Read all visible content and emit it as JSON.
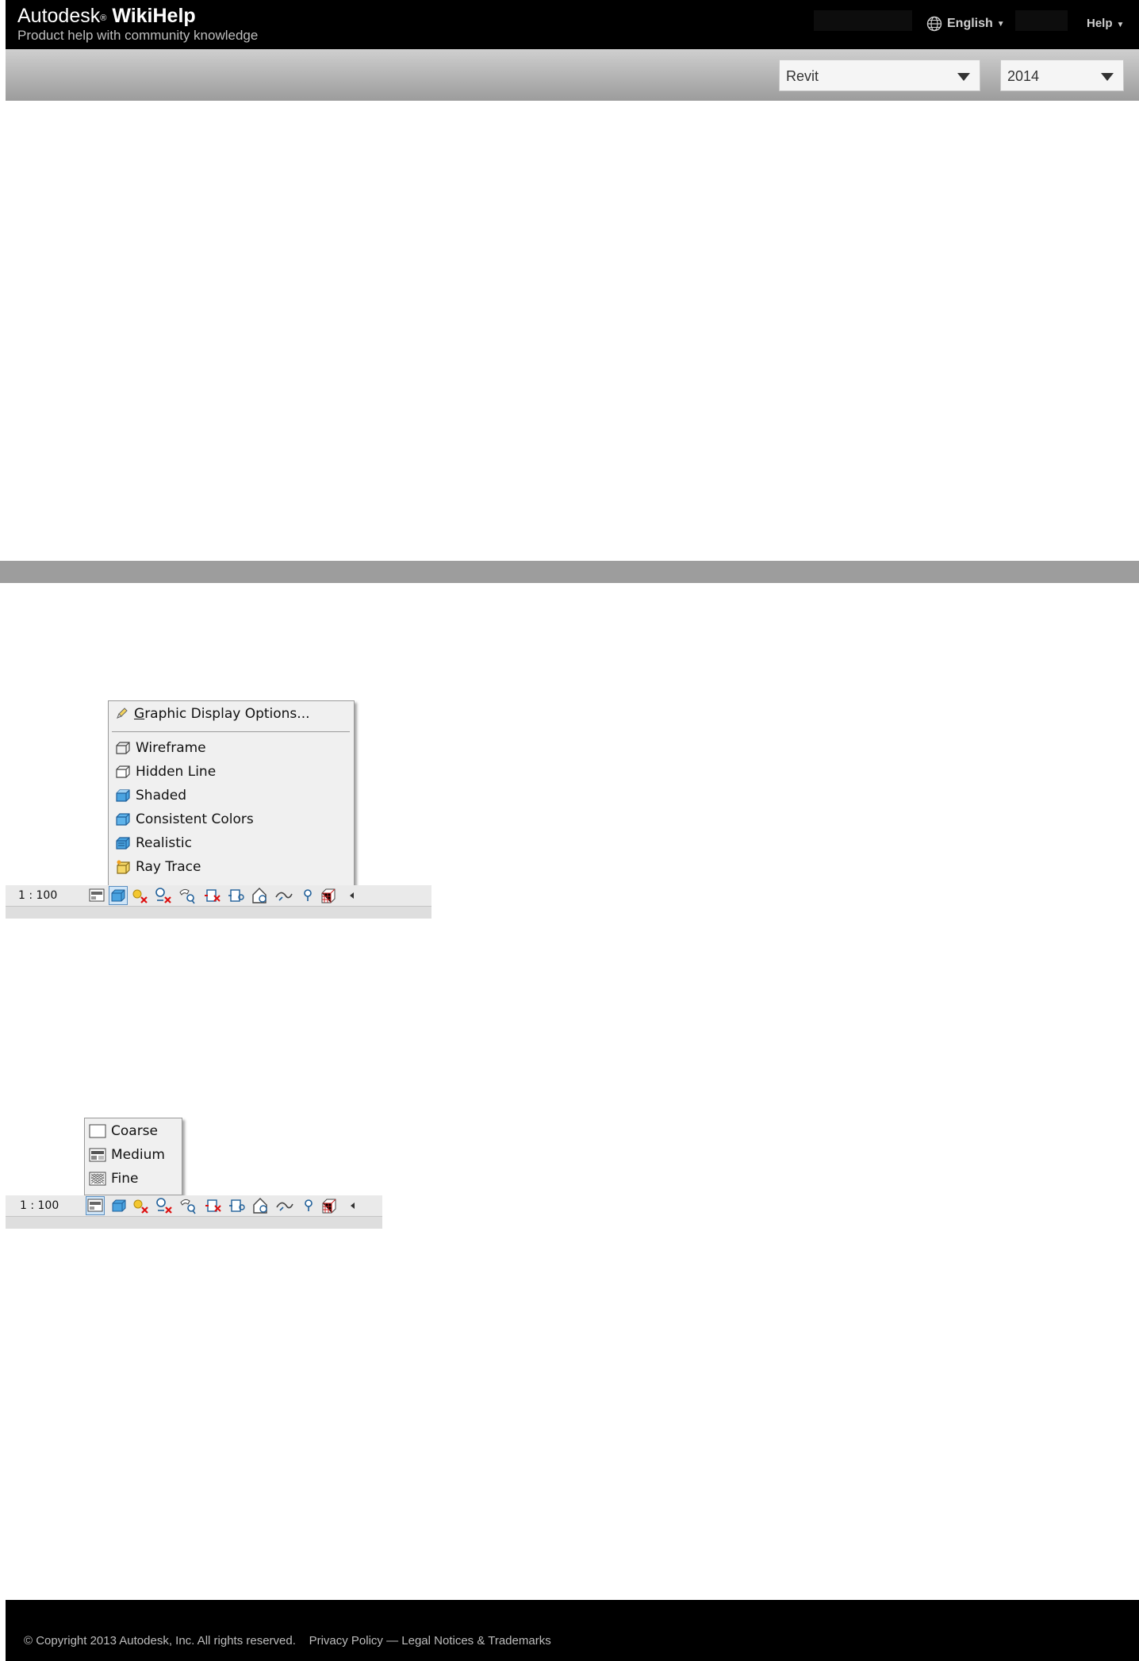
{
  "header": {
    "brand_prefix": "Autodesk",
    "brand_reg": "®",
    "brand_name": "WikiHelp",
    "tagline": "Product help with community knowledge",
    "language": "English",
    "help": "Help",
    "caret": "▼"
  },
  "selectors": {
    "product": "Revit",
    "version": "2014"
  },
  "screenshot1": {
    "scale": "1 : 100",
    "menu": {
      "top_item": "Graphic Display Options...",
      "top_item_accesskey": "G",
      "items": [
        "Wireframe",
        "Hidden Line",
        "Shaded",
        "Consistent Colors",
        "Realistic",
        "Ray Trace"
      ]
    }
  },
  "screenshot2": {
    "scale": "1 : 100",
    "menu": {
      "items": [
        "Coarse",
        "Medium",
        "Fine"
      ]
    }
  },
  "footer": {
    "copyright": "© Copyright 2013 Autodesk, Inc. All rights reserved.",
    "privacy": "Privacy Policy",
    "dash": "—",
    "legal": "Legal Notices & Trademarks"
  },
  "colors": {
    "header_bg": "#000000",
    "gray_band": "#9d9d9d",
    "menu_bg": "#f0f0f0",
    "icon_blue": "#3a8fd6"
  }
}
